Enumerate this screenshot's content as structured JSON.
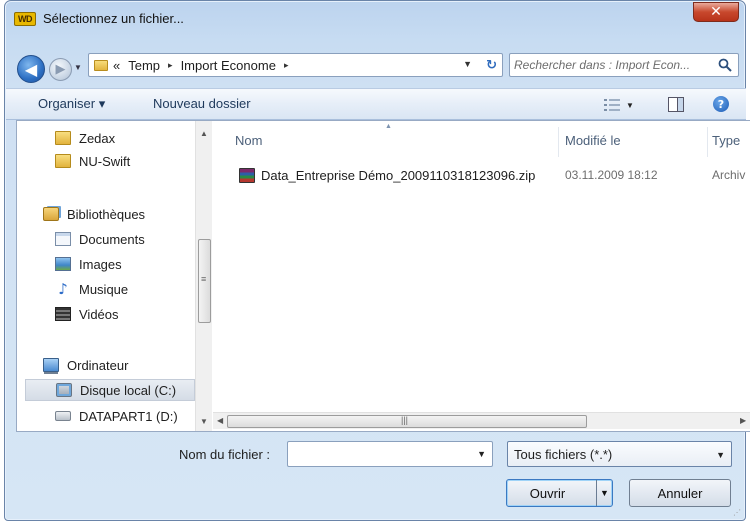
{
  "window": {
    "title": "Sélectionnez un fichier...",
    "app_logo_text": "WD",
    "close_symbol": "✕"
  },
  "address": {
    "prefix": "«",
    "crumbs": [
      "Temp",
      "Import Econome"
    ],
    "separator": "▸"
  },
  "search": {
    "placeholder": "Rechercher dans : Import Econ..."
  },
  "toolbar": {
    "organize_label": "Organiser ▾",
    "new_folder_label": "Nouveau dossier",
    "help_symbol": "?"
  },
  "nav": {
    "items": [
      {
        "label": "Zedax",
        "icon": "folder-icon"
      },
      {
        "label": "NU-Swift",
        "icon": "folder-icon"
      },
      {
        "label": "Bibliothèques",
        "icon": "library-icon"
      },
      {
        "label": "Documents",
        "icon": "documents-icon"
      },
      {
        "label": "Images",
        "icon": "images-icon"
      },
      {
        "label": "Musique",
        "icon": "music-icon"
      },
      {
        "label": "Vidéos",
        "icon": "videos-icon"
      },
      {
        "label": "Ordinateur",
        "icon": "computer-icon"
      },
      {
        "label": "Disque local (C:)",
        "icon": "local-disk-icon",
        "selected": true
      },
      {
        "label": "DATAPART1 (D:)",
        "icon": "drive-icon"
      }
    ]
  },
  "files": {
    "columns": [
      "Nom",
      "Modifié le",
      "Type"
    ],
    "rows": [
      {
        "name": "Data_Entreprise Démo_2009110318123096.zip",
        "modified": "03.11.2009 18:12",
        "type": "Archiv"
      }
    ]
  },
  "footer": {
    "filename_label": "Nom du fichier :",
    "filename_value": "",
    "filter_value": "Tous fichiers (*.*)",
    "open_label": "Ouvrir",
    "cancel_label": "Annuler"
  }
}
